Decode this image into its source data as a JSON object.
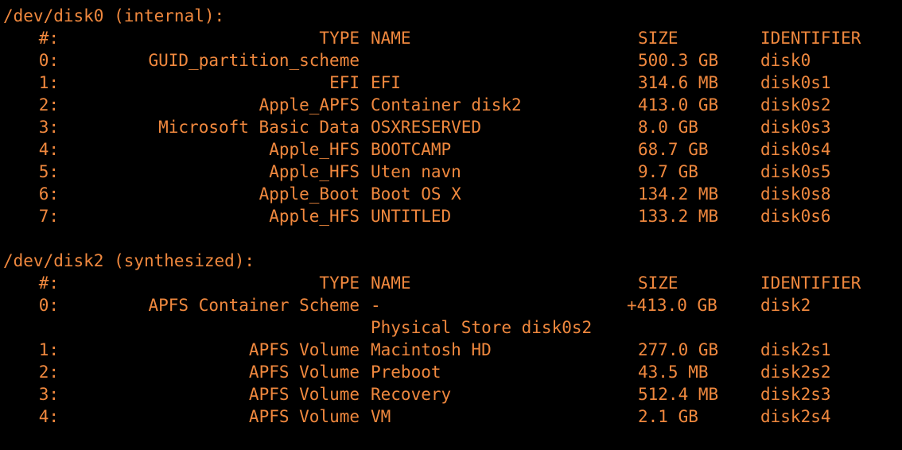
{
  "theme": {
    "foreground": "#f0883e",
    "background": "#000000"
  },
  "top_cutoff_text": "",
  "disks": [
    {
      "header": "/dev/disk0 (internal):",
      "columns": {
        "num": "#:",
        "type": "TYPE",
        "name": "NAME",
        "size": "SIZE",
        "identifier": "IDENTIFIER"
      },
      "rows": [
        {
          "num": "0:",
          "type": "GUID_partition_scheme",
          "name": "",
          "size": "500.3 GB",
          "identifier": "disk0"
        },
        {
          "num": "1:",
          "type": "EFI",
          "name": "EFI",
          "size": "314.6 MB",
          "identifier": "disk0s1"
        },
        {
          "num": "2:",
          "type": "Apple_APFS",
          "name": "Container disk2",
          "size": "413.0 GB",
          "identifier": "disk0s2"
        },
        {
          "num": "3:",
          "type": "Microsoft Basic Data",
          "name": "OSXRESERVED",
          "size": "8.0 GB",
          "identifier": "disk0s3"
        },
        {
          "num": "4:",
          "type": "Apple_HFS",
          "name": "BOOTCAMP",
          "size": "68.7 GB",
          "identifier": "disk0s4"
        },
        {
          "num": "5:",
          "type": "Apple_HFS",
          "name": "Uten navn",
          "size": "9.7 GB",
          "identifier": "disk0s5"
        },
        {
          "num": "6:",
          "type": "Apple_Boot",
          "name": "Boot OS X",
          "size": "134.2 MB",
          "identifier": "disk0s8"
        },
        {
          "num": "7:",
          "type": "Apple_HFS",
          "name": "UNTITLED",
          "size": "133.2 MB",
          "identifier": "disk0s6"
        }
      ]
    },
    {
      "header": "/dev/disk2 (synthesized):",
      "columns": {
        "num": "#:",
        "type": "TYPE",
        "name": "NAME",
        "size": "SIZE",
        "identifier": "IDENTIFIER"
      },
      "rows": [
        {
          "num": "0:",
          "type": "APFS Container Scheme",
          "name": "-",
          "size": "+413.0 GB",
          "identifier": "disk2"
        },
        {
          "num": "",
          "type": "",
          "name": "Physical Store disk0s2",
          "size": "",
          "identifier": ""
        },
        {
          "num": "1:",
          "type": "APFS Volume",
          "name": "Macintosh HD",
          "size": "277.0 GB",
          "identifier": "disk2s1"
        },
        {
          "num": "2:",
          "type": "APFS Volume",
          "name": "Preboot",
          "size": "43.5 MB",
          "identifier": "disk2s2"
        },
        {
          "num": "3:",
          "type": "APFS Volume",
          "name": "Recovery",
          "size": "512.4 MB",
          "identifier": "disk2s3"
        },
        {
          "num": "4:",
          "type": "APFS Volume",
          "name": "VM",
          "size": "2.1 GB",
          "identifier": "disk2s4"
        }
      ]
    }
  ]
}
